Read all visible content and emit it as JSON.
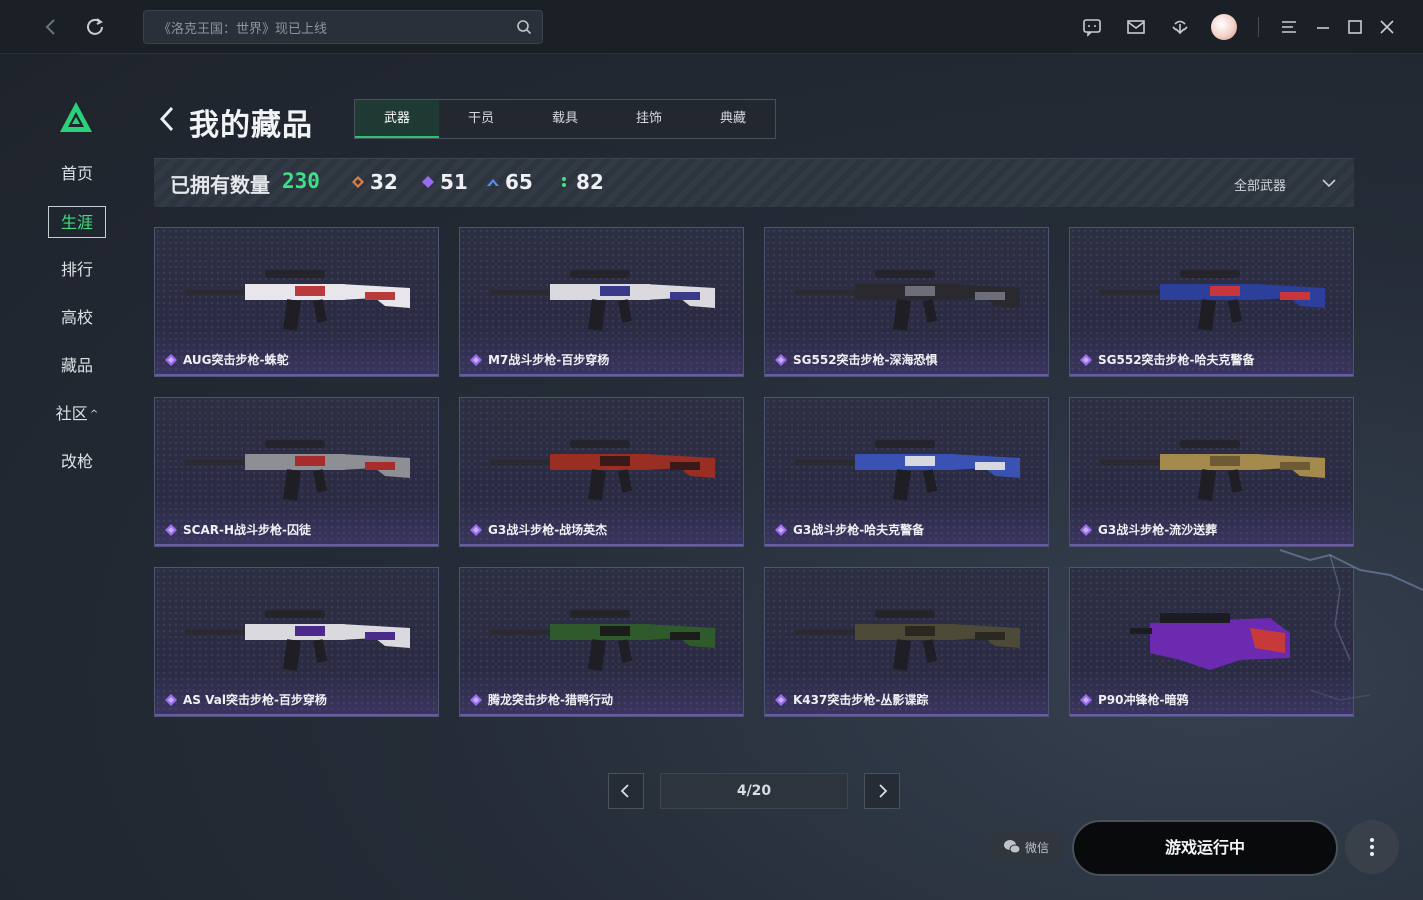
{
  "topbar": {
    "search_placeholder": "《洛克王国：世界》现已上线"
  },
  "sidebar": {
    "items": [
      {
        "label": "首页"
      },
      {
        "label": "生涯"
      },
      {
        "label": "排行"
      },
      {
        "label": "高校"
      },
      {
        "label": "藏品"
      },
      {
        "label": "社区"
      },
      {
        "label": "改枪"
      }
    ],
    "active_index": 1,
    "community_caret": "^"
  },
  "header": {
    "title": "我的藏品",
    "tabs": [
      {
        "label": "武器"
      },
      {
        "label": "干员"
      },
      {
        "label": "载具"
      },
      {
        "label": "挂饰"
      },
      {
        "label": "典藏"
      }
    ],
    "active_tab": 0
  },
  "stats": {
    "owned_label": "已拥有数量",
    "owned_total": "230",
    "rarity_counts": [
      {
        "value": "32",
        "color": "#e08040"
      },
      {
        "value": "51",
        "color": "#9b6cf0"
      },
      {
        "value": "65",
        "color": "#5a8ff0"
      },
      {
        "value": "82",
        "color": "#3fe08a"
      }
    ],
    "filter_label": "全部武器"
  },
  "items": [
    {
      "name": "AUG突击步枪-蛛鸵",
      "gun_color": "#e8e6ea",
      "accent": "#b83a3a"
    },
    {
      "name": "M7战斗步枪-百步穿杨",
      "gun_color": "#d9d9de",
      "accent": "#3a3a8a"
    },
    {
      "name": "SG552突击步枪-深海恐惧",
      "gun_color": "#2a2a2e",
      "accent": "#6e6e78"
    },
    {
      "name": "SG552突击步枪-哈夫克警备",
      "gun_color": "#2c3f9a",
      "accent": "#c8363a"
    },
    {
      "name": "SCAR-H战斗步枪-囚徒",
      "gun_color": "#8d8f95",
      "accent": "#a82c2c"
    },
    {
      "name": "G3战斗步枪-战场英杰",
      "gun_color": "#9a2e22",
      "accent": "#3a1a18"
    },
    {
      "name": "G3战斗步枪-哈夫克警备",
      "gun_color": "#3a52b4",
      "accent": "#d8d8e0"
    },
    {
      "name": "G3战斗步枪-流沙送葬",
      "gun_color": "#a58a4e",
      "accent": "#6e5a34"
    },
    {
      "name": "AS Val突击步枪-百步穿杨",
      "gun_color": "#dadade",
      "accent": "#4a2a8a"
    },
    {
      "name": "腾龙突击步枪-猎鸭行动",
      "gun_color": "#2f5a2c",
      "accent": "#1a1d1a"
    },
    {
      "name": "K437突击步枪-丛影谍踪",
      "gun_color": "#4d4a38",
      "accent": "#2a2820"
    },
    {
      "name": "P90冲锋枪-暗鸦",
      "gun_color": "#6b2ab0",
      "accent": "#c83a3a"
    }
  ],
  "pagination": {
    "indicator": "4/20"
  },
  "footer": {
    "wechat_label": "微信",
    "game_status": "游戏运行中"
  }
}
